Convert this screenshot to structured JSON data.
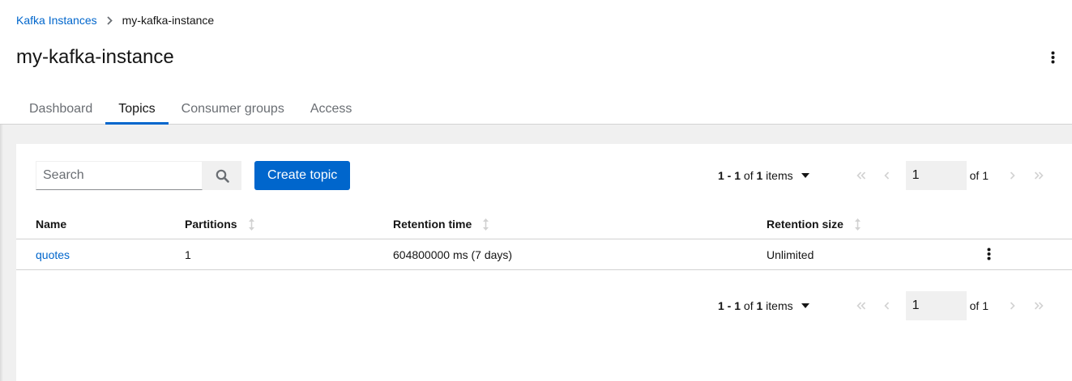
{
  "breadcrumb": {
    "parent": "Kafka Instances",
    "current": "my-kafka-instance"
  },
  "page": {
    "title": "my-kafka-instance"
  },
  "tabs": [
    {
      "label": "Dashboard"
    },
    {
      "label": "Topics"
    },
    {
      "label": "Consumer groups"
    },
    {
      "label": "Access"
    }
  ],
  "active_tab": "Topics",
  "toolbar": {
    "search_placeholder": "Search",
    "create_label": "Create topic"
  },
  "pagination": {
    "range": "1 - 1",
    "of_word": "of",
    "total": "1",
    "items_word": "items",
    "page": "1",
    "of_pages": "of 1"
  },
  "table": {
    "headers": [
      "Name",
      "Partitions",
      "Retention time",
      "Retention size"
    ],
    "rows": [
      {
        "name": "quotes",
        "partitions": "1",
        "retention_time": "604800000 ms (7 days)",
        "retention_size": "Unlimited"
      }
    ]
  },
  "icons": {
    "breadcrumb_separator": "chevron-right-icon",
    "kebab": "kebab-icon",
    "search": "search-icon",
    "caret": "caret-down-icon",
    "first": "angle-double-left-icon",
    "prev": "angle-left-icon",
    "next": "angle-right-icon",
    "last": "angle-double-right-icon",
    "sort": "sort-icon"
  },
  "colors": {
    "link": "#0066cc",
    "primary": "#0066cc",
    "disabled_icon": "#d2d2d2"
  }
}
